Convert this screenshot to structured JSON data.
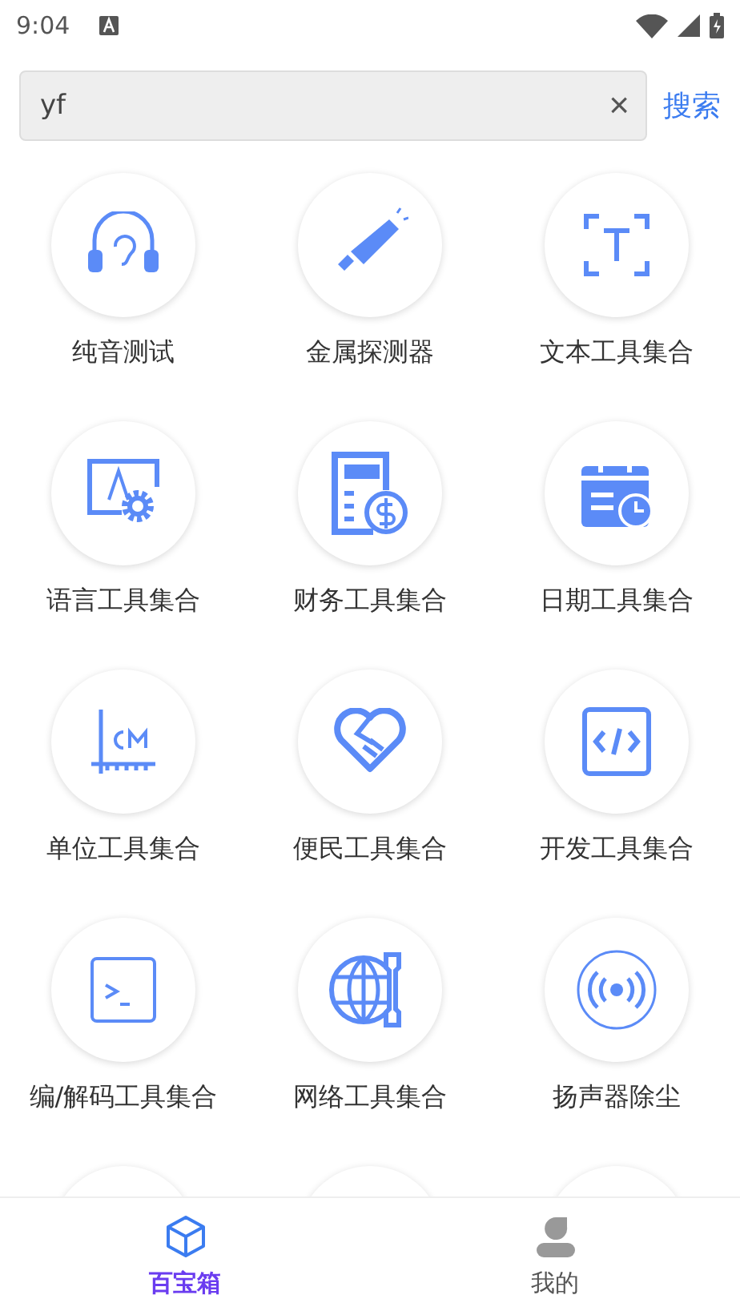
{
  "status_bar": {
    "time": "9:04"
  },
  "search": {
    "value": "yf",
    "clear": "×",
    "button": "搜索"
  },
  "tools": [
    {
      "label": "纯音测试"
    },
    {
      "label": "金属探测器"
    },
    {
      "label": "文本工具集合"
    },
    {
      "label": "语言工具集合"
    },
    {
      "label": "财务工具集合"
    },
    {
      "label": "日期工具集合"
    },
    {
      "label": "单位工具集合"
    },
    {
      "label": "便民工具集合"
    },
    {
      "label": "开发工具集合"
    },
    {
      "label": "编/解码工具集合"
    },
    {
      "label": "网络工具集合"
    },
    {
      "label": "扬声器除尘"
    }
  ],
  "bottom_nav": [
    {
      "label": "百宝箱",
      "selected": true
    },
    {
      "label": "我的",
      "selected": false
    }
  ]
}
